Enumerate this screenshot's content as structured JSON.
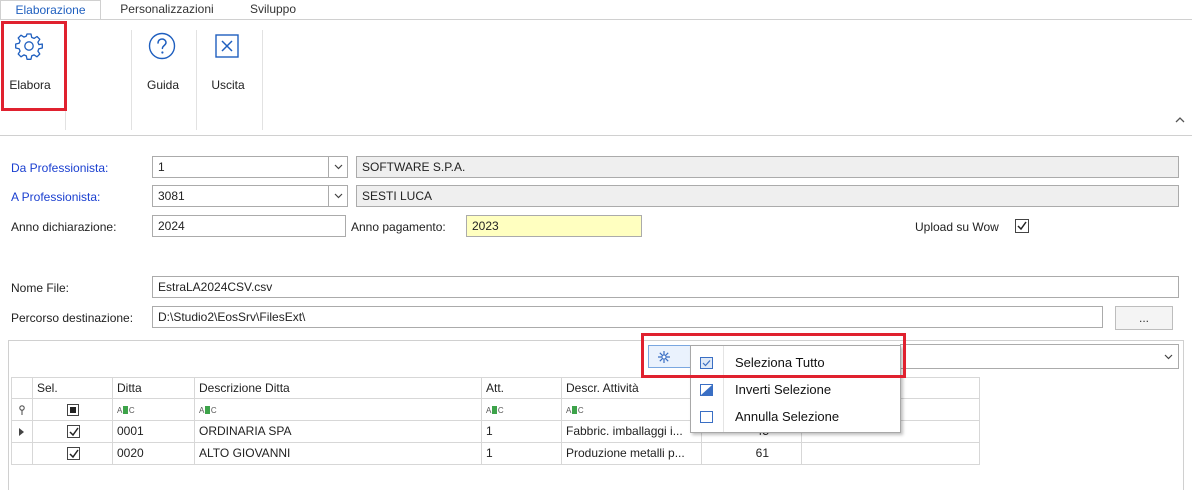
{
  "ribbon": {
    "tabs": [
      {
        "label": "Elaborazione"
      },
      {
        "label": "Personalizzazioni"
      },
      {
        "label": "Sviluppo"
      }
    ],
    "buttons": {
      "elabora": "Elabora",
      "guida": "Guida",
      "uscita": "Uscita"
    }
  },
  "form": {
    "da_professionista": {
      "label": "Da Professionista:",
      "code": "1",
      "name": "SOFTWARE S.P.A."
    },
    "a_professionista": {
      "label": "A Professionista:",
      "code": "3081",
      "name": "SESTI LUCA"
    },
    "anno_dichiarazione": {
      "label": "Anno dichiarazione:",
      "value": "2024"
    },
    "anno_pagamento": {
      "label": "Anno pagamento:",
      "value": "2023"
    },
    "upload_wow": {
      "label": "Upload su Wow",
      "checked": true
    },
    "nome_file": {
      "label": "Nome File:",
      "value": "EstraLA2024CSV.csv"
    },
    "percorso": {
      "label": "Percorso destinazione:",
      "value": "D:\\Studio2\\EosSrv\\FilesExt\\",
      "browse": "..."
    }
  },
  "grid": {
    "columns": [
      "Sel.",
      "Ditta",
      "Descrizione Ditta",
      "Att.",
      "Descr. Attività"
    ],
    "filter_glyph": "ABC",
    "rows": [
      {
        "sel": true,
        "ditta": "0001",
        "descrizione": "ORDINARIA SPA",
        "att": "1",
        "descr_attivita": "Fabbric. imballaggi i...",
        "value": "45"
      },
      {
        "sel": true,
        "ditta": "0020",
        "descrizione": "ALTO GIOVANNI",
        "att": "1",
        "descr_attivita": "Produzione metalli p...",
        "value": "61"
      }
    ]
  },
  "context_menu": {
    "items": [
      {
        "label": "Seleziona Tutto",
        "icon": "check-all-icon"
      },
      {
        "label": "Inverti Selezione",
        "icon": "invert-selection-icon"
      },
      {
        "label": "Annulla Selezione",
        "icon": "clear-selection-icon"
      }
    ]
  },
  "colors": {
    "accent": "#1f5fbf",
    "label_blue": "#1a3fd0",
    "highlight_red": "#e0212f",
    "yellow_field": "#ffffc0"
  }
}
